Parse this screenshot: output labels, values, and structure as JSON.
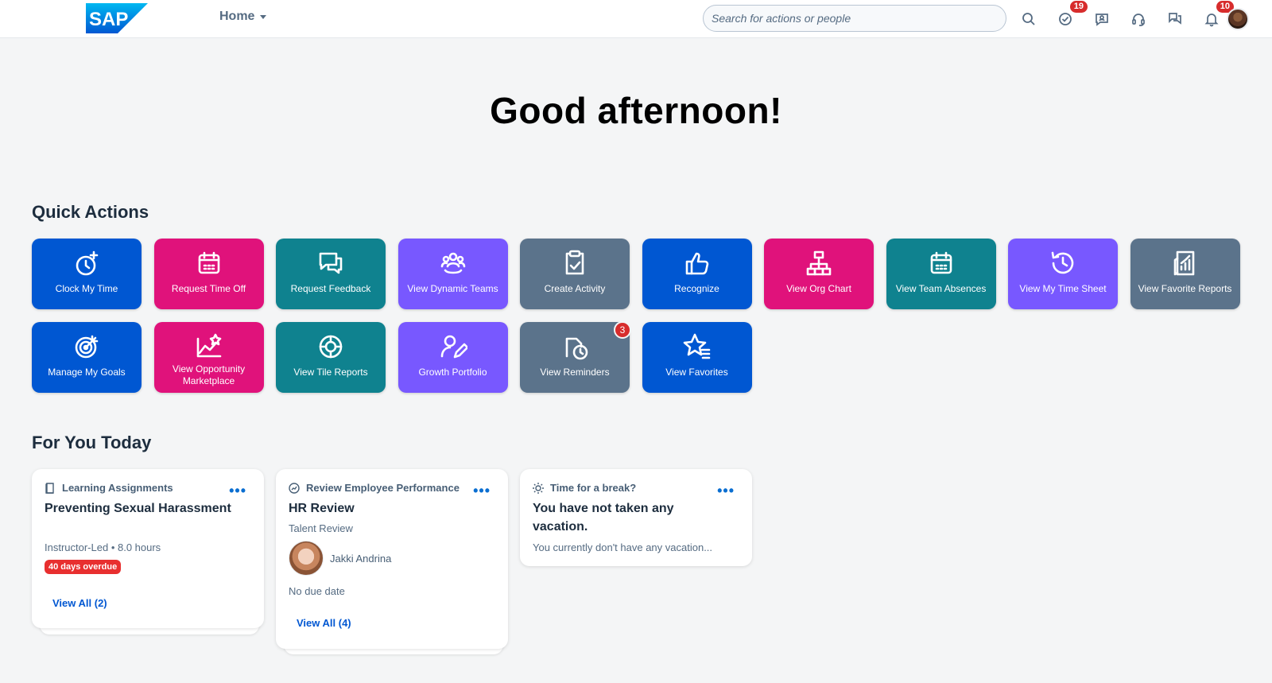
{
  "header": {
    "logo_text": "SAP",
    "home_label": "Home",
    "search_placeholder": "Search for actions or people",
    "todo_badge": "19",
    "notifications_badge": "10"
  },
  "greeting": "Good afternoon!",
  "quick_actions": {
    "title": "Quick Actions",
    "tiles": [
      {
        "label": "Clock My Time",
        "icon": "clock-add-icon",
        "color": "#0057d2"
      },
      {
        "label": "Request Time Off",
        "icon": "calendar-icon",
        "color": "#e0127b"
      },
      {
        "label": "Request Feedback",
        "icon": "feedback-icon",
        "color": "#0f828f"
      },
      {
        "label": "View Dynamic Teams",
        "icon": "team-icon",
        "color": "#7858ff"
      },
      {
        "label": "Create Activity",
        "icon": "clipboard-check-icon",
        "color": "#5b738b"
      },
      {
        "label": "Recognize",
        "icon": "thumbs-up-icon",
        "color": "#0057d2"
      },
      {
        "label": "View Org Chart",
        "icon": "org-chart-icon",
        "color": "#e0127b"
      },
      {
        "label": "View Team Absences",
        "icon": "calendar-icon",
        "color": "#0f828f"
      },
      {
        "label": "View My Time Sheet",
        "icon": "history-icon",
        "color": "#7858ff"
      },
      {
        "label": "View Favorite Reports",
        "icon": "report-icon",
        "color": "#5b738b"
      },
      {
        "label": "Manage My Goals",
        "icon": "target-icon",
        "color": "#0057d2"
      },
      {
        "label": "View Opportunity Marketplace",
        "icon": "opportunity-icon",
        "color": "#e0127b"
      },
      {
        "label": "View Tile Reports",
        "icon": "chart-donut-icon",
        "color": "#0f828f"
      },
      {
        "label": "Growth Portfolio",
        "icon": "person-edit-icon",
        "color": "#7858ff"
      },
      {
        "label": "View Reminders",
        "icon": "reminder-icon",
        "color": "#5b738b",
        "badge": "3"
      },
      {
        "label": "View Favorites",
        "icon": "favorite-list-icon",
        "color": "#0057d2"
      }
    ]
  },
  "for_you": {
    "title": "For You Today",
    "cards": [
      {
        "category": "Learning Assignments",
        "title": "Preventing Sexual Harassment",
        "meta": "Instructor-Led • 8.0 hours",
        "status": "40 days overdue",
        "link": "View All (2)"
      },
      {
        "category": "Review Employee Performance",
        "title": "HR Review",
        "meta": "Talent Review",
        "person": "Jakki Andrina",
        "due": "No due date",
        "link": "View All (4)"
      },
      {
        "category": "Time for a break?",
        "title": "You have not taken any vacation.",
        "meta": "You currently don't have any vacation..."
      }
    ]
  }
}
